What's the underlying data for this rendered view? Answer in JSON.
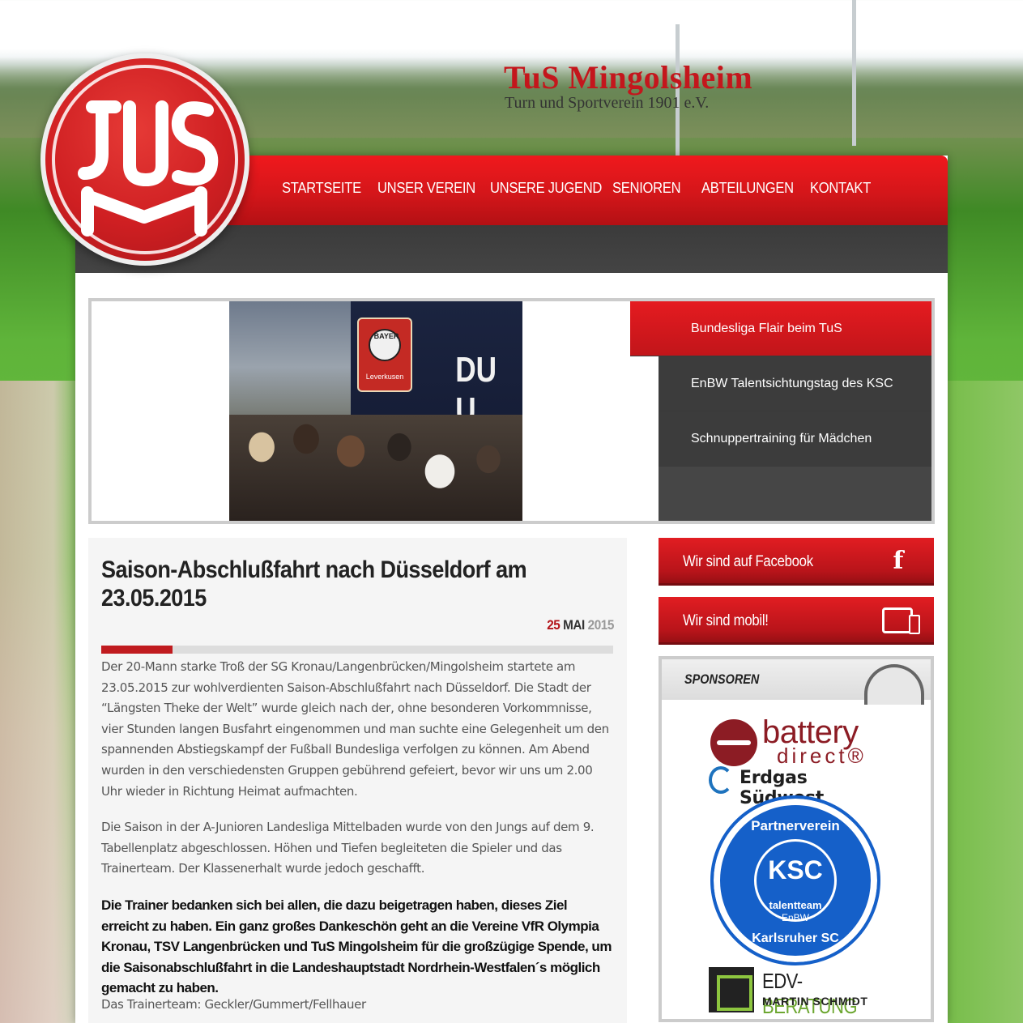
{
  "site": {
    "title": "TuS Mingolsheim",
    "subtitle": "Turn und Sportverein 1901 e.V.",
    "logo_text": "TuS M"
  },
  "nav": {
    "items": [
      {
        "label": "STARTSEITE"
      },
      {
        "label": "UNSER VEREIN"
      },
      {
        "label": "UNSERE JUGEND"
      },
      {
        "label": "SENIOREN"
      },
      {
        "label": "ABTEILUNGEN"
      },
      {
        "label": "KONTAKT"
      }
    ]
  },
  "slider": {
    "photo_text": "DU U",
    "photo_badge": "BAYER",
    "photo_badge_sub": "Leverkusen",
    "links": [
      {
        "label": "Bundesliga Flair beim TuS",
        "active": true
      },
      {
        "label": "EnBW Talentsichtungstag des KSC",
        "active": false
      },
      {
        "label": "Schnuppertraining für Mädchen",
        "active": false
      }
    ]
  },
  "article": {
    "title": "Saison-Abschlußfahrt nach Düsseldorf am 23.05.2015",
    "date": {
      "day": "25",
      "month": "MAI",
      "year": "2015"
    },
    "read_progress": 0.14,
    "paragraphs": [
      "Der 20-Mann starke Troß der SG Kronau/Langenbrücken/Mingolsheim startete am 23.05.2015 zur wohlverdienten Saison-Abschlußfahrt nach Düsseldorf. Die Stadt der “Längsten Theke der Welt” wurde gleich nach der, ohne besonderen Vorkommnisse, vier Stunden langen Busfahrt eingenommen und man suchte eine Gelegenheit um den spannenden Abstiegskampf der Fußball Bundesliga verfolgen zu können. Am Abend wurden in den verschiedensten Gruppen gebührend gefeiert, bevor wir uns um 2.00 Uhr wieder in Richtung Heimat aufmachten.",
      "Die Saison in der A-Junioren Landesliga Mittelbaden wurde von den Jungs auf dem 9. Tabellenplatz abgeschlossen. Höhen und Tiefen begleiteten die Spieler und das Trainerteam. Der Klassenerhalt wurde jedoch geschafft.",
      "Die Trainer bedanken sich bei allen, die dazu beigetragen haben, dieses Ziel erreicht zu haben. Ein ganz großes Dankeschön geht an die Vereine VfR Olympia Kronau, TSV Langenbrücken und TuS Mingolsheim für die großzügige Spende, um die Saisonabschlußfahrt in die Landeshauptstadt Nordrhein-Westfalen´s möglich gemacht zu haben.",
      "Das Trainerteam: Geckler/Gummert/Fellhauer"
    ]
  },
  "sidebar": {
    "facebook_label": "Wir sind auf Facebook",
    "facebook_icon": "f",
    "mobile_label": "Wir sind mobil!",
    "sponsors_heading": "SPONSOREN",
    "sponsors": {
      "battery": "battery",
      "battery_sub": "direct®",
      "erdgas": "Erdgas Südwest",
      "ksc_top": "Partnerverein",
      "ksc_mid": "KSC",
      "ksc_team": "talentteam",
      "ksc_enbw": "EnBW",
      "ksc_bottom": "Karlsruher SC",
      "edv_title_1": "EDV-",
      "edv_title_2": "BERATUNG",
      "edv_sub": "MARTIN SCHMIDT"
    }
  },
  "colors": {
    "brand_red": "#c4161c",
    "nav_dark": "#444444",
    "ksc_blue": "#1560c9",
    "edv_green": "#6da731"
  }
}
